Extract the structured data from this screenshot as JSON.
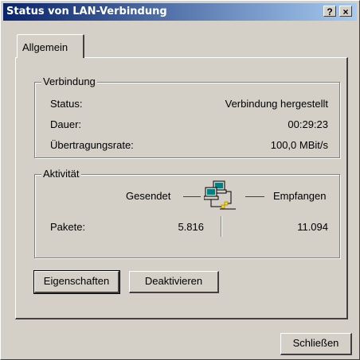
{
  "window": {
    "title": "Status von LAN-Verbindung",
    "help_btn": "?",
    "close_btn": "×"
  },
  "tabs": [
    {
      "label": "Allgemein"
    }
  ],
  "connection": {
    "title": "Verbindung",
    "status_label": "Status:",
    "status_value": "Verbindung hergestellt",
    "duration_label": "Dauer:",
    "duration_value": "00:29:23",
    "rate_label": "Übertragungsrate:",
    "rate_value": "100,0 MBit/s"
  },
  "activity": {
    "title": "Aktivität",
    "sent_label": "Gesendet",
    "received_label": "Empfangen",
    "packets_label": "Pakete:",
    "packets_sent": "5.816",
    "packets_received": "11.094",
    "icon": "network-computers-icon"
  },
  "buttons": {
    "properties": "Eigenschaften",
    "disable": "Deaktivieren",
    "close": "Schließen"
  }
}
